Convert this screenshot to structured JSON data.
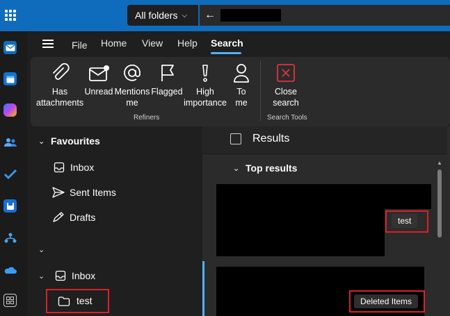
{
  "topbar": {
    "scope_label": "All folders",
    "search_placeholder": ""
  },
  "menu": {
    "tabs": [
      {
        "label": "File"
      },
      {
        "label": "Home"
      },
      {
        "label": "View"
      },
      {
        "label": "Help"
      },
      {
        "label": "Search"
      }
    ],
    "active_tab": "Search"
  },
  "ribbon": {
    "refiners": [
      {
        "line1": "Has",
        "line2": "attachments",
        "icon": "paperclip-icon"
      },
      {
        "line1": "Unread",
        "line2": "",
        "icon": "envelope-dot-icon"
      },
      {
        "line1": "Mentions",
        "line2": "me",
        "icon": "at-icon"
      },
      {
        "line1": "Flagged",
        "line2": "",
        "icon": "flag-icon"
      },
      {
        "line1": "High",
        "line2": "importance",
        "icon": "exclamation-icon"
      },
      {
        "line1": "To",
        "line2": "me",
        "icon": "person-icon"
      }
    ],
    "refiners_label": "Refiners",
    "close_search": {
      "line1": "Close",
      "line2": "search",
      "icon": "close-search-icon"
    },
    "search_tools_label": "Search Tools"
  },
  "folders": {
    "favourites_label": "Favourites",
    "favourites": [
      {
        "label": "Inbox",
        "icon": "inbox-icon"
      },
      {
        "label": "Sent Items",
        "icon": "send-icon"
      },
      {
        "label": "Drafts",
        "icon": "pencil-icon"
      }
    ],
    "inbox_label": "Inbox",
    "subfolder_label": "test"
  },
  "results": {
    "header_label": "Results",
    "top_results_label": "Top results",
    "items": [
      {
        "folder_tag": "test"
      },
      {
        "folder_tag": "Deleted Items"
      }
    ]
  },
  "colors": {
    "accent": "#0f6cbd",
    "highlight": "#d9202b",
    "selection": "#4fb2ff"
  }
}
